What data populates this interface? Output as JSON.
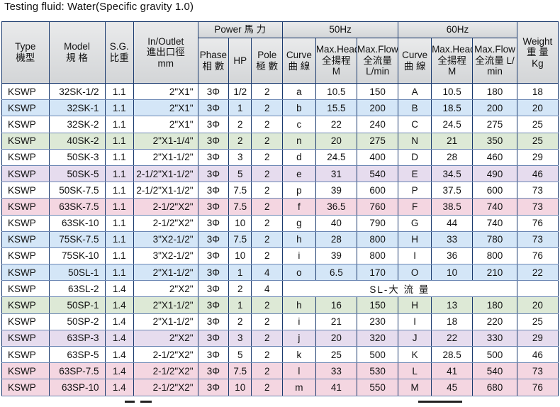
{
  "fluid_note": "Testing fluid: Water(Specific gravity 1.0)",
  "header": {
    "type": "Type",
    "type_cn": "機型",
    "model": "Model",
    "model_cn": "規 格",
    "sg": "S.G.",
    "sg_cn": "比重",
    "io": "In/Outlet",
    "io_cn": "進出口徑",
    "io_unit": "mm",
    "power": "Power 馬 力",
    "hz50": "50Hz",
    "hz60": "60Hz",
    "weight": "Weight",
    "weight_cn": "重 量",
    "weight_unit": "Kg",
    "phase": "Phase",
    "phase_cn": "相 數",
    "hp": "HP",
    "pole": "Pole",
    "pole_cn": "極 數",
    "curve": "Curve",
    "curve_cn": "曲 線",
    "head": "Max.Head",
    "head_cn": "全揚程",
    "head_unit": "M",
    "flow": "Max.Flow",
    "flow_cn": "全流量",
    "flow_cn60": "全流量 L/",
    "flow_unit": "L/min",
    "flow_unit60": "min"
  },
  "rows": [
    {
      "type": "KSWP",
      "model": "32SK-1/2",
      "sg": "1.1",
      "io": "2\"X1\"",
      "phase": "3Φ",
      "hp": "1/2",
      "pole": "2",
      "c50": "a",
      "h50": "10.5",
      "f50": "150",
      "c60": "A",
      "h60": "10.5",
      "f60": "180",
      "wt": "18",
      "bg": "w"
    },
    {
      "type": "KSWP",
      "model": "32SK-1",
      "sg": "1.1",
      "io": "2\"X1\"",
      "phase": "3Φ",
      "hp": "1",
      "pole": "2",
      "c50": "b",
      "h50": "15.5",
      "f50": "200",
      "c60": "B",
      "h60": "18.5",
      "f60": "200",
      "wt": "20",
      "bg": "b"
    },
    {
      "type": "KSWP",
      "model": "32SK-2",
      "sg": "1.1",
      "io": "2\"X1\"",
      "phase": "3Φ",
      "hp": "2",
      "pole": "2",
      "c50": "c",
      "h50": "22",
      "f50": "240",
      "c60": "C",
      "h60": "24.5",
      "f60": "275",
      "wt": "25",
      "bg": "w"
    },
    {
      "type": "KSWP",
      "model": "40SK-2",
      "sg": "1.1",
      "io": "2\"X1-1/4\"",
      "phase": "3Φ",
      "hp": "2",
      "pole": "2",
      "c50": "n",
      "h50": "20",
      "f50": "275",
      "c60": "N",
      "h60": "21",
      "f60": "350",
      "wt": "25",
      "bg": "g"
    },
    {
      "type": "KSWP",
      "model": "50SK-3",
      "sg": "1.1",
      "io": "2\"X1-1/2\"",
      "phase": "3Φ",
      "hp": "3",
      "pole": "2",
      "c50": "d",
      "h50": "24.5",
      "f50": "400",
      "c60": "D",
      "h60": "28",
      "f60": "460",
      "wt": "29",
      "bg": "w"
    },
    {
      "type": "KSWP",
      "model": "50SK-5",
      "sg": "1.1",
      "io": "2-1/2\"X1-1/2\"",
      "phase": "3Φ",
      "hp": "5",
      "pole": "2",
      "c50": "e",
      "h50": "31",
      "f50": "540",
      "c60": "E",
      "h60": "34.5",
      "f60": "490",
      "wt": "46",
      "bg": "p"
    },
    {
      "type": "KSWP",
      "model": "50SK-7.5",
      "sg": "1.1",
      "io": "2-1/2\"X1-1/2\"",
      "phase": "3Φ",
      "hp": "7.5",
      "pole": "2",
      "c50": "p",
      "h50": "39",
      "f50": "600",
      "c60": "P",
      "h60": "37.5",
      "f60": "600",
      "wt": "73",
      "bg": "w"
    },
    {
      "type": "KSWP",
      "model": "63SK-7.5",
      "sg": "1.1",
      "io": "2-1/2\"X2\"",
      "phase": "3Φ",
      "hp": "7.5",
      "pole": "2",
      "c50": "f",
      "h50": "36.5",
      "f50": "760",
      "c60": "F",
      "h60": "38.5",
      "f60": "740",
      "wt": "73",
      "bg": "k"
    },
    {
      "type": "KSWP",
      "model": "63SK-10",
      "sg": "1.1",
      "io": "2-1/2\"X2\"",
      "phase": "3Φ",
      "hp": "10",
      "pole": "2",
      "c50": "g",
      "h50": "40",
      "f50": "790",
      "c60": "G",
      "h60": "44",
      "f60": "740",
      "wt": "76",
      "bg": "w"
    },
    {
      "type": "KSWP",
      "model": "75SK-7.5",
      "sg": "1.1",
      "io": "3\"X2-1/2\"",
      "phase": "3Φ",
      "hp": "7.5",
      "pole": "2",
      "c50": "h",
      "h50": "28",
      "f50": "800",
      "c60": "H",
      "h60": "33",
      "f60": "780",
      "wt": "73",
      "bg": "b"
    },
    {
      "type": "KSWP",
      "model": "75SK-10",
      "sg": "1.1",
      "io": "3\"X2-1/2\"",
      "phase": "3Φ",
      "hp": "10",
      "pole": "2",
      "c50": "i",
      "h50": "39",
      "f50": "800",
      "c60": "I",
      "h60": "36",
      "f60": "800",
      "wt": "76",
      "bg": "w"
    },
    {
      "type": "KSWP",
      "model": "50SL-1",
      "sg": "1.1",
      "io": "2\"X1-1/2\"",
      "phase": "3Φ",
      "hp": "1",
      "pole": "4",
      "c50": "o",
      "h50": "6.5",
      "f50": "170",
      "c60": "O",
      "h60": "10",
      "f60": "210",
      "wt": "22",
      "bg": "b"
    },
    {
      "type": "KSWP",
      "model": "63SL-2",
      "sg": "1.4",
      "io": "2\"X2\"",
      "phase": "3Φ",
      "hp": "2",
      "pole": "4",
      "span": "SL-大 流 量",
      "wt": "",
      "bg": "w"
    },
    {
      "type": "KSWP",
      "model": "50SP-1",
      "sg": "1.4",
      "io": "2\"X1-1/2\"",
      "phase": "3Φ",
      "hp": "1",
      "pole": "2",
      "c50": "h",
      "h50": "16",
      "f50": "150",
      "c60": "H",
      "h60": "13",
      "f60": "180",
      "wt": "20",
      "bg": "g"
    },
    {
      "type": "KSWP",
      "model": "50SP-2",
      "sg": "1.4",
      "io": "2\"X1-1/2\"",
      "phase": "3Φ",
      "hp": "2",
      "pole": "2",
      "c50": "i",
      "h50": "21",
      "f50": "230",
      "c60": "I",
      "h60": "18",
      "f60": "220",
      "wt": "25",
      "bg": "w"
    },
    {
      "type": "KSWP",
      "model": "63SP-3",
      "sg": "1.4",
      "io": "2\"X2\"",
      "phase": "3Φ",
      "hp": "3",
      "pole": "2",
      "c50": "j",
      "h50": "20",
      "f50": "320",
      "c60": "J",
      "h60": "22",
      "f60": "330",
      "wt": "29",
      "bg": "p"
    },
    {
      "type": "KSWP",
      "model": "63SP-5",
      "sg": "1.4",
      "io": "2-1/2\"X2\"",
      "phase": "3Φ",
      "hp": "5",
      "pole": "2",
      "c50": "k",
      "h50": "25",
      "f50": "500",
      "c60": "K",
      "h60": "28.5",
      "f60": "500",
      "wt": "46",
      "bg": "w"
    },
    {
      "type": "KSWP",
      "model": "63SP-7.5",
      "sg": "1.4",
      "io": "2-1/2\"X2\"",
      "phase": "3Φ",
      "hp": "7.5",
      "pole": "2",
      "c50": "l",
      "h50": "33",
      "f50": "530",
      "c60": "L",
      "h60": "41",
      "f60": "540",
      "wt": "73",
      "bg": "k"
    },
    {
      "type": "KSWP",
      "model": "63SP-10",
      "sg": "1.4",
      "io": "2-1/2\"X2\"",
      "phase": "3Φ",
      "hp": "10",
      "pole": "2",
      "c50": "m",
      "h50": "41",
      "f50": "550",
      "c60": "M",
      "h60": "45",
      "f60": "680",
      "wt": "76",
      "bg": "k"
    }
  ],
  "colors": {
    "border": "#1a3a6e",
    "row_blue": "#d4e6f7",
    "row_green": "#dde9d6",
    "row_purple": "#e6dcee",
    "row_pink": "#f4d6e1",
    "header_bg": "#dfe1e3"
  }
}
